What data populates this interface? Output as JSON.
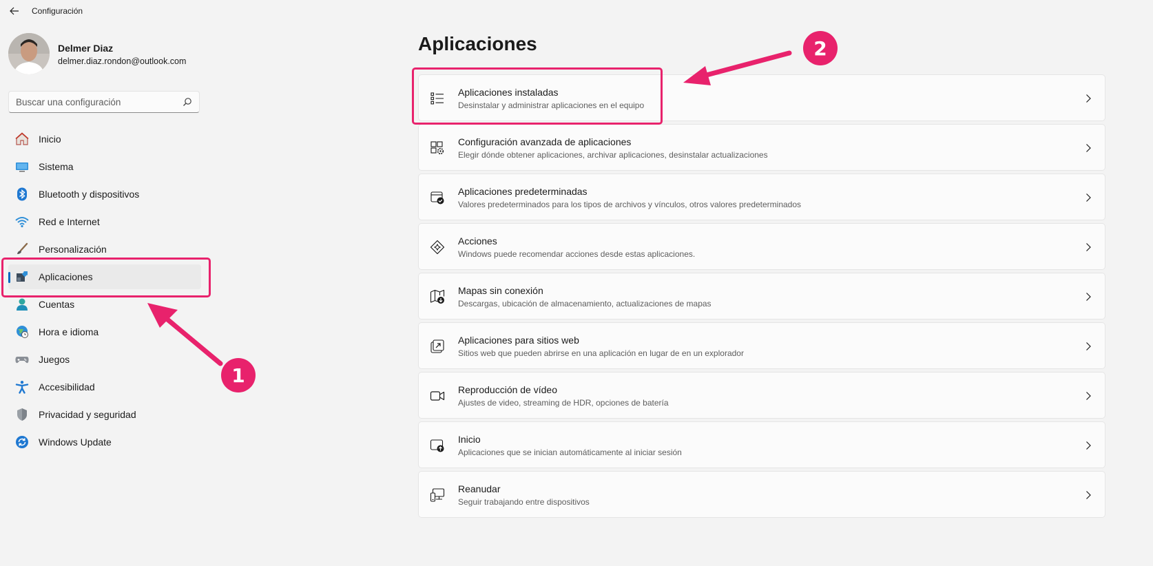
{
  "window": {
    "title": "Configuración"
  },
  "profile": {
    "name": "Delmer Diaz",
    "email": "delmer.diaz.rondon@outlook.com"
  },
  "search": {
    "placeholder": "Buscar una configuración"
  },
  "sidebar": {
    "items": [
      {
        "label": "Inicio",
        "icon": "home-icon"
      },
      {
        "label": "Sistema",
        "icon": "monitor-icon"
      },
      {
        "label": "Bluetooth y dispositivos",
        "icon": "bluetooth-icon"
      },
      {
        "label": "Red e Internet",
        "icon": "wifi-icon"
      },
      {
        "label": "Personalización",
        "icon": "brush-icon"
      },
      {
        "label": "Aplicaciones",
        "icon": "apps-icon",
        "selected": true
      },
      {
        "label": "Cuentas",
        "icon": "person-icon"
      },
      {
        "label": "Hora e idioma",
        "icon": "globe-clock-icon"
      },
      {
        "label": "Juegos",
        "icon": "gamepad-icon"
      },
      {
        "label": "Accesibilidad",
        "icon": "accessibility-icon"
      },
      {
        "label": "Privacidad y seguridad",
        "icon": "shield-icon"
      },
      {
        "label": "Windows Update",
        "icon": "update-icon"
      }
    ]
  },
  "main": {
    "title": "Aplicaciones",
    "items": [
      {
        "title": "Aplicaciones instaladas",
        "desc": "Desinstalar y administrar aplicaciones en el equipo",
        "icon": "list-icon"
      },
      {
        "title": "Configuración avanzada de aplicaciones",
        "desc": "Elegir dónde obtener aplicaciones, archivar aplicaciones, desinstalar actualizaciones",
        "icon": "apps-gear-icon"
      },
      {
        "title": "Aplicaciones predeterminadas",
        "desc": "Valores predeterminados para los tipos de archivos y vínculos, otros valores predeterminados",
        "icon": "default-apps-icon"
      },
      {
        "title": "Acciones",
        "desc": "Windows puede recomendar acciones desde estas aplicaciones.",
        "icon": "sparkle-icon"
      },
      {
        "title": "Mapas sin conexión",
        "desc": "Descargas, ubicación de almacenamiento, actualizaciones de mapas",
        "icon": "map-download-icon"
      },
      {
        "title": "Aplicaciones para sitios web",
        "desc": "Sitios web que pueden abrirse en una aplicación en lugar de en un explorador",
        "icon": "open-in-app-icon"
      },
      {
        "title": "Reproducción de vídeo",
        "desc": "Ajustes de video, streaming de HDR, opciones de batería",
        "icon": "video-icon"
      },
      {
        "title": "Inicio",
        "desc": "Aplicaciones que se inician automáticamente al iniciar sesión",
        "icon": "startup-icon"
      },
      {
        "title": "Reanudar",
        "desc": "Seguir trabajando entre dispositivos",
        "icon": "devices-icon"
      }
    ]
  },
  "annotations": {
    "badge1": "1",
    "badge2": "2",
    "color": "#e8226c"
  },
  "colors": {
    "accent": "#0067c0",
    "background": "#f3f3f3",
    "card": "#fbfbfb"
  }
}
